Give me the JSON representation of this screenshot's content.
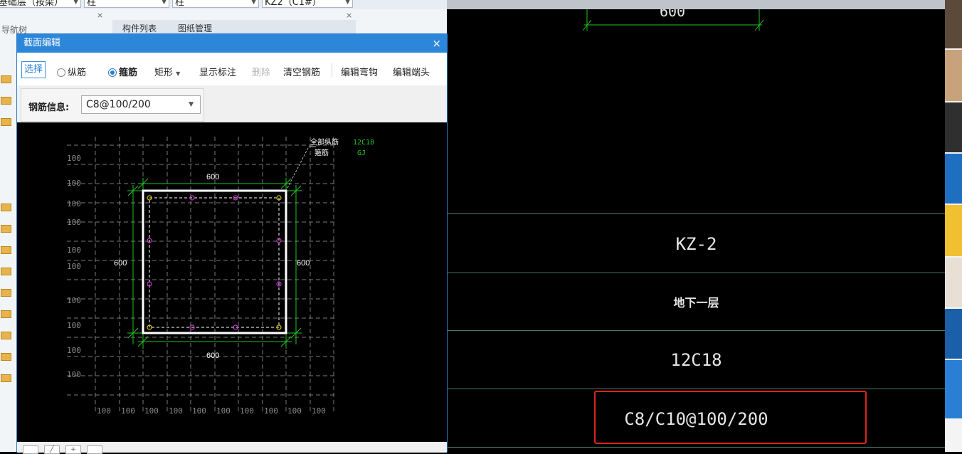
{
  "topbar": {
    "floor_select": "基础层（按梁）",
    "category_select": "柱",
    "type_select": "柱",
    "element_select": "KZ2（C1#）"
  },
  "left_panel": {
    "nav_title": "导航树",
    "tabs": [
      "构件列表",
      "图纸管理"
    ]
  },
  "dialog": {
    "title": "截面编辑",
    "close_glyph": "×",
    "toolbar": {
      "select_btn": "选择",
      "longitudinal": "纵筋",
      "stirrup": "箍筋",
      "shape": "矩形",
      "show_labels": "显示标注",
      "delete": "删除",
      "clear": "清空钢筋",
      "edit_hook": "编辑弯钩",
      "edit_end": "编辑端头"
    },
    "rebar_info_label": "钢筋信息:",
    "rebar_info_value": "C8@100/200",
    "drawing": {
      "dim_top": "600",
      "dim_bottom": "600",
      "dim_left": "600",
      "dim_right": "600",
      "legend_line1_label": "全部纵筋",
      "legend_line1_value": "12C18",
      "legend_line2_label": "箍筋",
      "legend_line2_value": "GJ",
      "grid_row_label": "100",
      "grid_col_label": "100",
      "colors": {
        "section": "#ffffff",
        "dimension": "#22c422",
        "rebar": "#d030d0",
        "corner_rebar": "#e0c000",
        "legend_value": "#22c422"
      }
    }
  },
  "cad": {
    "top_dim": "600",
    "rows": [
      "KZ-2",
      "地下一层",
      "12C18",
      "C8/C10@100/200"
    ],
    "highlight_color": "#e0241b"
  }
}
